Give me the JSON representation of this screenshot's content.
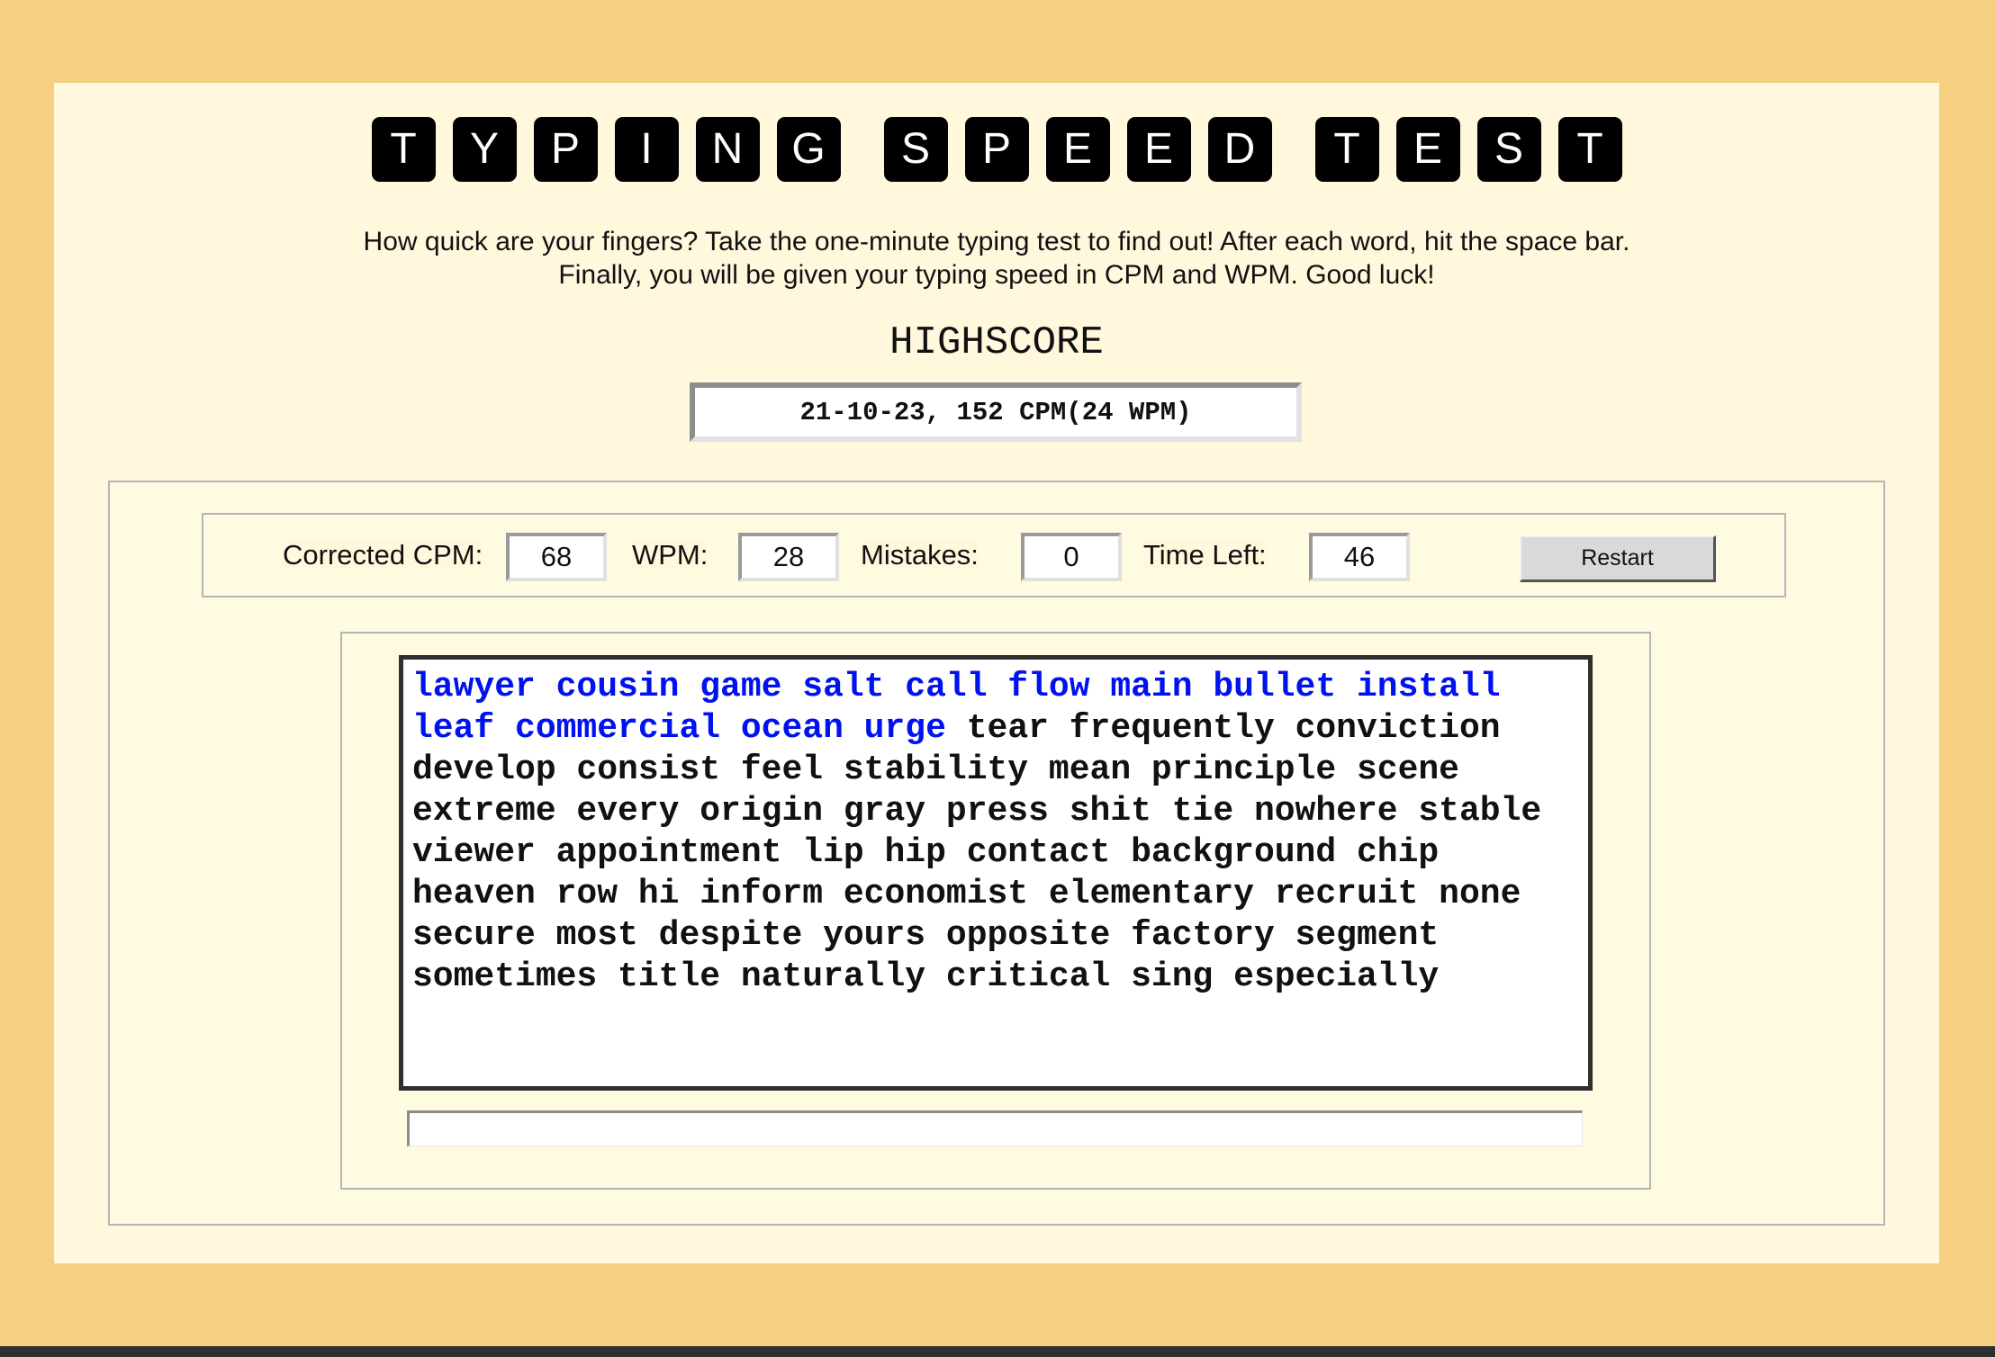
{
  "title": {
    "words": [
      [
        "T",
        "Y",
        "P",
        "I",
        "N",
        "G"
      ],
      [
        "S",
        "P",
        "E",
        "E",
        "D"
      ],
      [
        "T",
        "E",
        "S",
        "T"
      ]
    ]
  },
  "intro": {
    "line1": "How quick are your fingers? Take the one-minute typing test to find out! After each word, hit the space bar.",
    "line2": "Finally, you will be given your typing speed in CPM and WPM. Good luck!"
  },
  "highscore": {
    "label": "HIGHSCORE",
    "value": "21-10-23, 152 CPM(24 WPM)"
  },
  "stats": {
    "cpm_label": "Corrected CPM:",
    "cpm_value": "68",
    "wpm_label": "WPM:",
    "wpm_value": "28",
    "mistakes_label": "Mistakes:",
    "mistakes_value": "0",
    "time_label": "Time Left:",
    "time_value": "46",
    "restart_label": "Restart"
  },
  "words": {
    "typed": "lawyer cousin game salt call flow main bullet install leaf commercial ocean urge",
    "remaining": "tear frequently conviction develop consist feel stability mean principle scene extreme every origin gray press shit tie nowhere stable viewer appointment lip hip contact background chip heaven row hi inform economist elementary recruit none secure most despite yours opposite factory segment sometimes title naturally critical sing especially"
  },
  "input": {
    "value": ""
  },
  "colors": {
    "background": "#f7cf82",
    "page": "#fff8dd",
    "typed_word": "#0012ee",
    "tile": "#000000"
  }
}
